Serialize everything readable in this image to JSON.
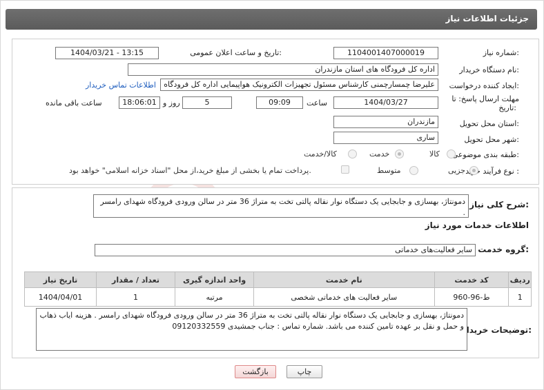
{
  "header": {
    "title": "جزئیات اطلاعات نیاز"
  },
  "fields": {
    "need_number_label": "شماره نیاز:",
    "need_number": "1104001407000019",
    "announce_label": "تاریخ و ساعت اعلان عمومی:",
    "announce_value": "1404/03/21 - 13:15",
    "buyer_org_label": "نام دستگاه خریدار:",
    "buyer_org": "اداره کل فرودگاه های استان مازندران",
    "creator_label": "ایجاد کننده درخواست:",
    "creator": "علیرضا چمسارچمنی کارشناس مسئول تجهیزات الکترونیک هواپیمایی اداره کل فرودگاه های استان مازندران",
    "contact_link": "اطلاعات تماس خریدار",
    "deadline_label": "مهلت ارسال پاسخ: تا",
    "deadline_label2": "تاریخ:",
    "deadline_date": "1404/03/27",
    "time_label": "ساعت",
    "deadline_time": "09:09",
    "days": "5",
    "days_label": "روز و",
    "remaining": "18:06:01",
    "remaining_label": "ساعت باقی مانده",
    "province_label": "استان محل تحویل:",
    "province": "مازندران",
    "city_label": "شهر محل تحویل:",
    "city": "ساری",
    "category_label": "طبقه بندی موضوعی:",
    "category_options": [
      "کالا",
      "خدمت",
      "کالا/خدمت"
    ],
    "process_label": "نوع فرآیند خرید :",
    "process_options": [
      "جزیی",
      "متوسط"
    ],
    "payment_note": "پرداخت تمام یا بخشی از مبلغ خرید،از محل \"اسناد خزانه اسلامی\" خواهد بود."
  },
  "general_desc": {
    "label": "شرح کلی نیاز:",
    "text": "دمونتاژ، بهسازی و جابجایی یک دستگاه نوار نقاله پالتی تخت به متراژ 36 متر در سالن ورودی فرودگاه شهدای رامسر ."
  },
  "services": {
    "section_title": "اطلاعات خدمات مورد نیاز",
    "group_label": "گروه خدمت:",
    "group_value": "سایر فعالیت‌های خدماتی",
    "columns": [
      "ردیف",
      "کد خدمت",
      "نام خدمت",
      "واحد اندازه گیری",
      "تعداد / مقدار",
      "تاریخ نیاز"
    ],
    "rows": [
      [
        "1",
        "ط-96-960",
        "سایر فعالیت های خدماتی شخصی",
        "مرتبه",
        "1",
        "1404/04/01"
      ]
    ]
  },
  "buyer_notes": {
    "label": "توضیحات خریدار:",
    "text": "دمونتاژ، بهسازی و جابجایی یک دستگاه نوار نقاله پالتی تخت به متراژ 36 متر در سالن ورودی فرودگاه شهدای رامسر . هزینه ایاب ذهاب و حمل  و نقل بر عهده تامین کننده می باشد. شماره تماس : جناب جمشیدی 09120332559"
  },
  "buttons": {
    "print": "چاپ",
    "back": "بازگشت"
  },
  "watermark": {
    "text": "AriaTender.neT",
    "color": "#c0392b"
  }
}
